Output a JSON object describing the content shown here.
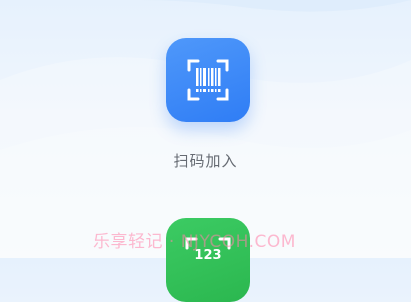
{
  "scan_action": {
    "label": "扫码加入",
    "icon": "barcode-scan-icon",
    "color": "#3a87f8"
  },
  "code_action": {
    "icon_text": "123",
    "icon": "code-entry-icon",
    "color": "#33c159"
  },
  "watermark": {
    "text": "乐享轻记 · NJYCOH.COM"
  }
}
